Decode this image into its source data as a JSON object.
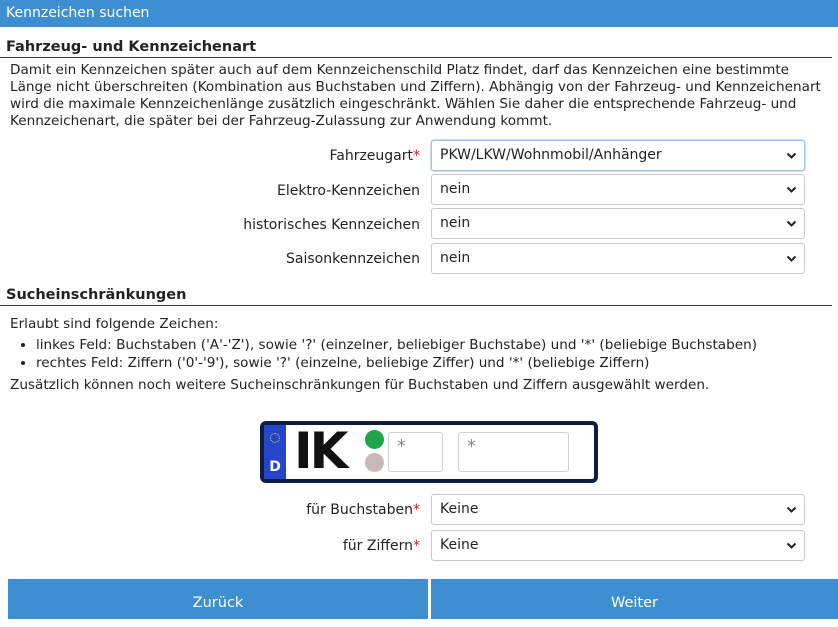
{
  "window": {
    "title": "Kennzeichen suchen"
  },
  "section1": {
    "heading": "Fahrzeug- und Kennzeichenart",
    "lines": [
      "Damit ein Kennzeichen später auch auf dem Kennzeichenschild Platz findet, darf das Kennzeichen eine bestimmte",
      "Länge nicht überschreiten (Kombination aus Buchstaben und Ziffern). Abhängig von der Fahrzeug- und Kennzeichenart",
      "wird die maximale Kennzeichenlänge zusätzlich eingeschränkt. Wählen Sie daher die entsprechende Fahrzeug- und",
      "Kennzeichenart, die später bei der Fahrzeug-Zulassung zur Anwendung kommt."
    ]
  },
  "fields": {
    "fahrzeugart": {
      "label": "Fahrzeugart",
      "required": "*",
      "value": "PKW/LKW/Wohnmobil/Anhänger"
    },
    "elektro": {
      "label": "Elektro-Kennzeichen",
      "value": "nein"
    },
    "historisch": {
      "label": "historisches Kennzeichen",
      "value": "nein"
    },
    "saison": {
      "label": "Saisonkennzeichen",
      "value": "nein"
    }
  },
  "section2": {
    "heading": "Sucheinschränkungen",
    "intro": "Erlaubt sind folgende Zeichen:",
    "rules": [
      "linkes Feld: Buchstaben ('A'-'Z'), sowie '?' (einzelner, beliebiger Buchstabe) und '*' (beliebige Buchstaben)",
      "rechtes Feld: Ziffern ('0'-'9'), sowie '?' (einzelne, beliebige Ziffer) und '*' (beliebige Ziffern)"
    ],
    "note": "Zusätzlich können noch weitere Sucheinschränkungen für Buchstaben und Ziffern ausgewählt werden."
  },
  "plate": {
    "country": "D",
    "district": "IK",
    "letters_value": "*",
    "digits_value": "*"
  },
  "restrictions": {
    "buchstaben": {
      "label": "für Buchstaben",
      "required": "*",
      "value": "Keine"
    },
    "ziffern": {
      "label": "für Ziffern",
      "required": "*",
      "value": "Keine"
    }
  },
  "buttons": {
    "back": "Zurück",
    "next": "Weiter"
  },
  "colors": {
    "accent": "#3d8fd1",
    "required": "#d21f1f",
    "plate_border": "#0f1d3f",
    "eu_blue": "#2546c9"
  }
}
